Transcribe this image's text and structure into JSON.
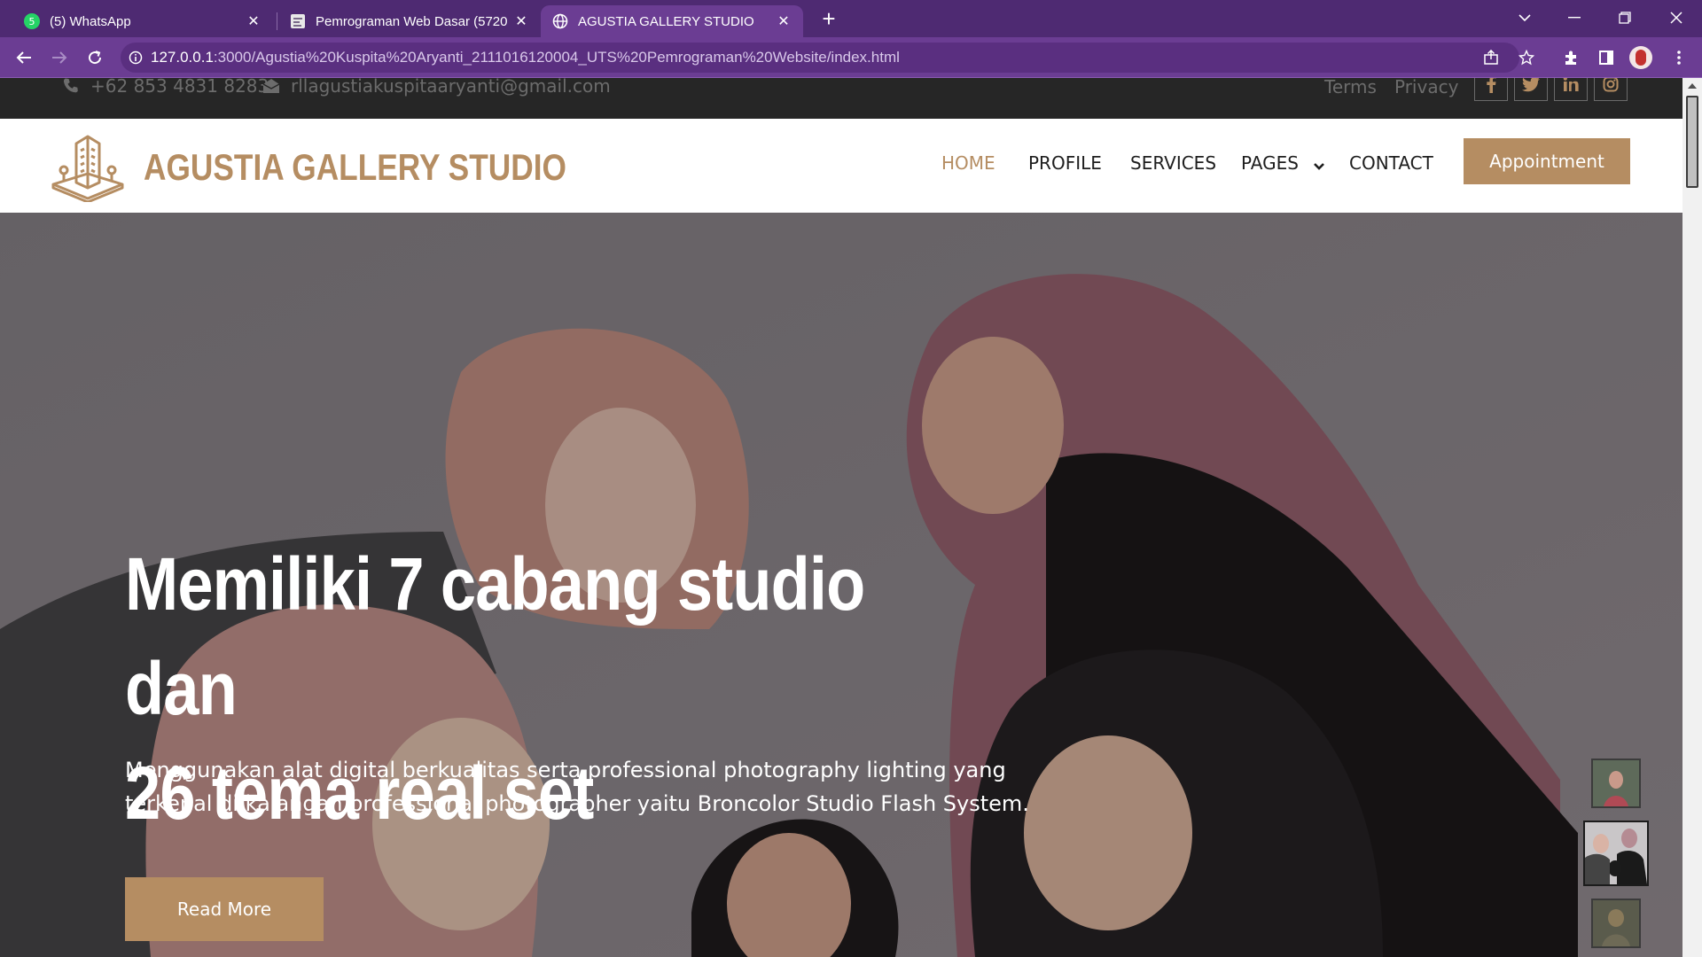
{
  "browser": {
    "tabs": [
      {
        "title": "(5) WhatsApp",
        "favicon": "whatsapp-icon",
        "active": false
      },
      {
        "title": "Pemrograman Web Dasar (5720",
        "favicon": "document-icon",
        "active": false
      },
      {
        "title": "AGUSTIA GALLERY STUDIO",
        "favicon": "globe-icon",
        "active": true
      }
    ],
    "whatsapp_badge": "5",
    "url_host": "127.0.0.1",
    "url_path": ":3000/Agustia%20Kuspita%20Aryanti_2111016120004_UTS%20Pemrograman%20Website/index.html"
  },
  "topbar": {
    "phone": "+62 853 4831 8283",
    "email": "rllagustiakuspitaaryanti@gmail.com",
    "links": [
      "Terms",
      "Privacy"
    ],
    "social": [
      {
        "icon": "facebook-icon",
        "label": "f"
      },
      {
        "icon": "twitter-icon",
        "label": "t"
      },
      {
        "icon": "linkedin-icon",
        "label": "in"
      },
      {
        "icon": "instagram-icon",
        "label": "ig"
      }
    ]
  },
  "navbar": {
    "brand": "AGUSTIA GALLERY STUDIO",
    "menu": [
      "HOME",
      "PROFILE",
      "SERVICES",
      "PAGES",
      "CONTACT"
    ],
    "active_item": "HOME",
    "cta": "Appointment"
  },
  "hero": {
    "title_line1": "Memiliki 7 cabang studio dan",
    "title_line2": "26 tema real set",
    "description_line1": "Menggunakan alat digital berkualitas serta professional photography lighting yang",
    "description_line2": "terkenal di kalangan professional photographer yaitu Broncolor Studio Flash System.",
    "button": "Read More"
  },
  "colors": {
    "accent": "#b58d62",
    "browser_frame": "#4e2a72",
    "browser_toolbar": "#6b3d93",
    "topbar": "#262626"
  }
}
